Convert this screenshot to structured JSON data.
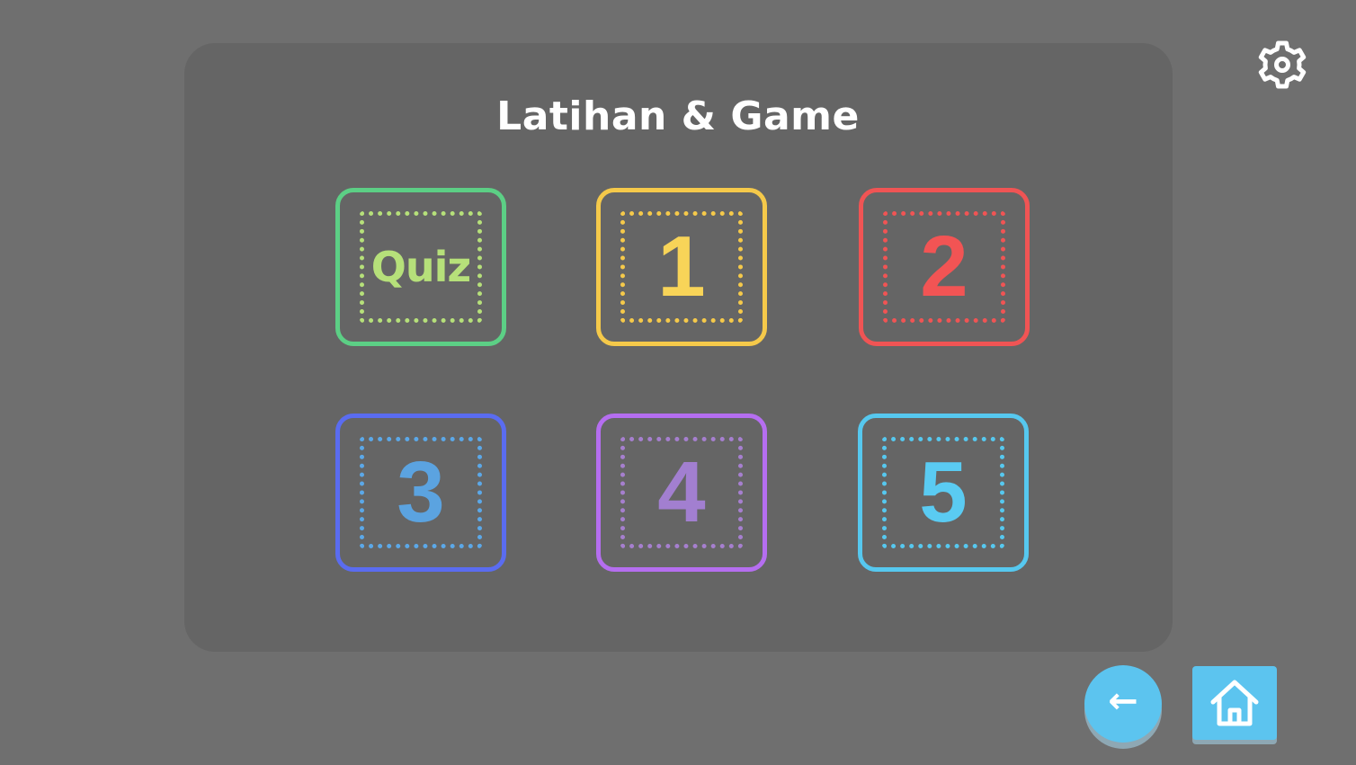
{
  "screen": {
    "title": "Latihan & Game"
  },
  "tiles": [
    {
      "label": "Quiz",
      "outer_color": "#5ccf85",
      "inner_color": "#b6e07a",
      "text_color": "#b6e07a"
    },
    {
      "label": "1",
      "outer_color": "#f5c94a",
      "inner_color": "#f5c94a",
      "text_color": "#f8d458"
    },
    {
      "label": "2",
      "outer_color": "#f05454",
      "inner_color": "#f05454",
      "text_color": "#f25454"
    },
    {
      "label": "3",
      "outer_color": "#5a6cf0",
      "inner_color": "#5ba8e8",
      "text_color": "#5ba3e0"
    },
    {
      "label": "4",
      "outer_color": "#b56ef0",
      "inner_color": "#a67fcf",
      "text_color": "#a27fd0"
    },
    {
      "label": "5",
      "outer_color": "#56c8ef",
      "inner_color": "#56c8ef",
      "text_color": "#5acbf2"
    }
  ],
  "controls": {
    "settings_icon": "gear-icon",
    "back_icon": "arrow-left-icon",
    "back_glyph": "←",
    "home_icon": "home-icon"
  },
  "colors": {
    "background": "#6f6f6f",
    "panel": "#656565",
    "accent": "#5cc4ef",
    "title": "#ffffff"
  }
}
